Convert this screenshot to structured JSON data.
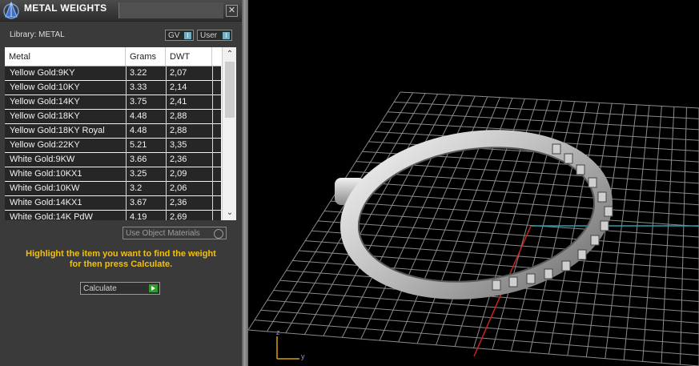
{
  "window": {
    "title": "METAL WEIGHTS",
    "close_glyph": "✕"
  },
  "library": {
    "label": "Library: METAL"
  },
  "toggles": [
    {
      "label": "GV",
      "indicator": "I"
    },
    {
      "label": "User",
      "indicator": "I"
    }
  ],
  "table": {
    "columns": [
      "Metal",
      "Grams",
      "DWT"
    ],
    "rows": [
      [
        "Yellow Gold:9KY",
        "3.22",
        "2,07"
      ],
      [
        "Yellow Gold:10KY",
        "3.33",
        "2,14"
      ],
      [
        "Yellow Gold:14KY",
        "3.75",
        "2,41"
      ],
      [
        "Yellow Gold:18KY",
        "4.48",
        "2,88"
      ],
      [
        "Yellow Gold:18KY Royal",
        "4.48",
        "2,88"
      ],
      [
        "Yellow Gold:22KY",
        "5.21",
        "3,35"
      ],
      [
        "White Gold:9KW",
        "3.66",
        "2,36"
      ],
      [
        "White Gold:10KX1",
        "3.25",
        "2,09"
      ],
      [
        "White Gold:10KW",
        "3.2",
        "2,06"
      ],
      [
        "White Gold:14KX1",
        "3.67",
        "2,36"
      ],
      [
        "White Gold:14K PdW",
        "4.19",
        "2,69"
      ]
    ],
    "scroll_up_glyph": "⌃",
    "scroll_down_glyph": "⌄"
  },
  "options": {
    "use_object_materials": "Use Object Materials"
  },
  "instructions": {
    "line1": "Highlight the item you want to find the weight",
    "line2": "for then press Calculate."
  },
  "calculate": {
    "label": "Calculate"
  },
  "axes": {
    "z": "z",
    "y": "y"
  },
  "colors": {
    "panel_bg": "#3a3a3a",
    "instruction_text": "#f0c010",
    "calculate_icon": "#2e9d2e",
    "grid_line": "#8a8a8a",
    "axis_red": "#cc2222",
    "axis_cyan": "#2aa0b0"
  }
}
